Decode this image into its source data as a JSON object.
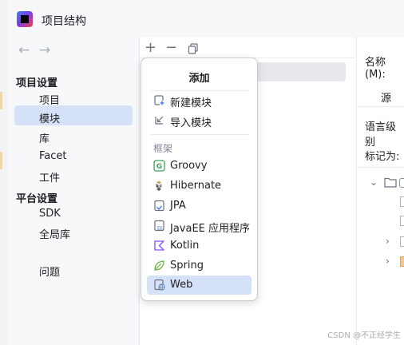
{
  "window": {
    "title": "项目结构"
  },
  "nav": {
    "back_icon": "arrow-left-icon",
    "forward_icon": "arrow-right-icon"
  },
  "sidebar": {
    "project_settings_header": "项目设置",
    "project_items": [
      "项目",
      "模块",
      "库",
      "Facet",
      "工件"
    ],
    "platform_settings_header": "平台设置",
    "platform_items": [
      "SDK",
      "全局库"
    ],
    "problems": "问题",
    "selected": "模块"
  },
  "toolbar": {
    "add_icon": "plus-icon",
    "remove_icon": "minus-icon",
    "copy_icon": "copy-icon"
  },
  "right_panel": {
    "name_label": "名称(M):",
    "source_tab": "源",
    "language_level_label": "语言级别",
    "mark_as_label": "标记为:"
  },
  "popup": {
    "title": "添加",
    "new_module": "新建模块",
    "import_module": "导入模块",
    "frameworks_header": "框架",
    "frameworks": [
      "Groovy",
      "Hibernate",
      "JPA",
      "JavaEE 应用程序",
      "Kotlin",
      "Spring",
      "Web"
    ],
    "selected": "Web"
  },
  "colors": {
    "selection": "#d5e1f7",
    "groovy": "#3fa35a",
    "kotlin": "#7f52ff",
    "spring": "#6db33f",
    "web": "#4a7bd0"
  },
  "watermark": "CSDN @不正经学生"
}
